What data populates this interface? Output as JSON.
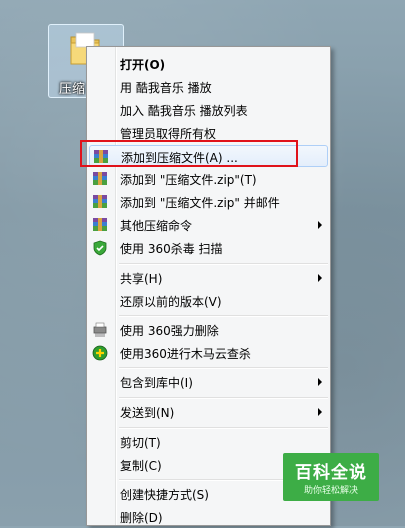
{
  "desktop": {
    "icon_label": "压缩"
  },
  "menu": {
    "items": [
      {
        "label": "打开(O)",
        "bold": true,
        "icon": null
      },
      {
        "label": "用 酷我音乐 播放",
        "icon": null
      },
      {
        "label": "加入 酷我音乐 播放列表",
        "icon": null
      },
      {
        "label": "管理员取得所有权",
        "icon": null
      },
      {
        "label": "添加到压缩文件(A) ...",
        "icon": "winrar-icon"
      },
      {
        "label": "添加到 \"压缩文件.zip\"(T)",
        "icon": "winrar-icon"
      },
      {
        "label": "添加到 \"压缩文件.zip\" 并邮件",
        "icon": "winrar-icon"
      },
      {
        "label": "其他压缩命令",
        "icon": "winrar-icon",
        "submenu": true
      },
      {
        "label": "使用 360杀毒 扫描",
        "icon": "shield-icon"
      },
      {
        "label": "共享(H)",
        "submenu": true
      },
      {
        "label": "还原以前的版本(V)"
      },
      {
        "label": "使用 360强力删除",
        "icon": "shredder-icon"
      },
      {
        "label": "使用360进行木马云查杀",
        "icon": "cloud-scan-icon"
      },
      {
        "label": "包含到库中(I)",
        "submenu": true
      },
      {
        "label": "发送到(N)",
        "submenu": true
      },
      {
        "label": "剪切(T)"
      },
      {
        "label": "复制(C)"
      },
      {
        "label": "创建快捷方式(S)"
      },
      {
        "label": "删除(D)"
      }
    ]
  },
  "watermark": {
    "title": "百科全说",
    "subtitle": "助你轻松解决"
  },
  "colors": {
    "highlight_border": "#e0121a",
    "watermark_bg": "#3dad46"
  }
}
